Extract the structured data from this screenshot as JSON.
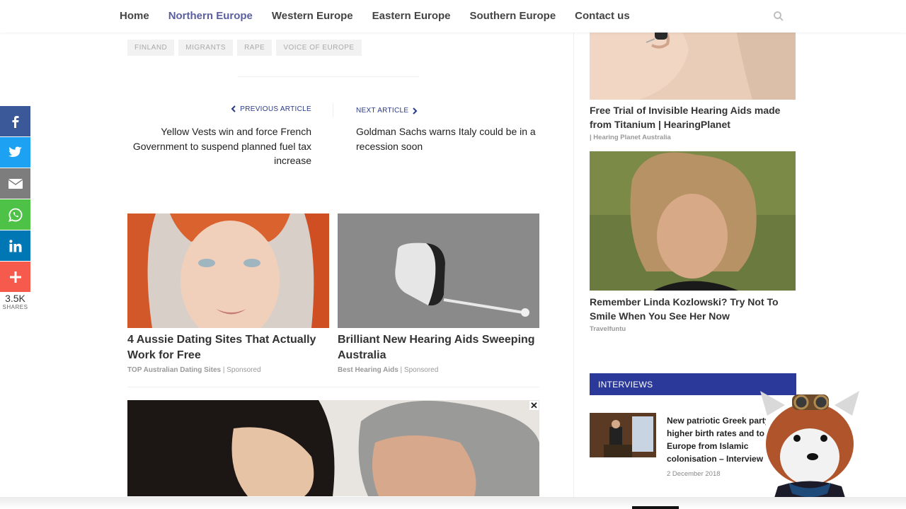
{
  "nav": {
    "items": [
      "Home",
      "Northern Europe",
      "Western Europe",
      "Eastern Europe",
      "Southern Europe",
      "Contact us"
    ],
    "active": "Northern Europe",
    "search_icon": "search-icon"
  },
  "tags": [
    "FINLAND",
    "MIGRANTS",
    "RAPE",
    "VOICE OF EUROPE"
  ],
  "article_nav": {
    "prev_label": "PREVIOUS ARTICLE",
    "prev_title": "Yellow Vests win and force French Government to suspend planned fuel tax increase",
    "next_label": "NEXT ARTICLE",
    "next_title": "Goldman Sachs warns Italy could be in a recession soon"
  },
  "sponsored": [
    {
      "title": "4 Aussie Dating Sites That Actually Work for Free",
      "source": "TOP Australian Dating Sites",
      "tag": "Sponsored"
    },
    {
      "title": "Brilliant New Hearing Aids Sweeping Australia",
      "source": "Best Hearing Aids",
      "tag": "Sponsored"
    }
  ],
  "close_symbol": "✕",
  "sidebar": {
    "ad1": {
      "title": "Free Trial of Invisible Hearing Aids made from Titanium | HearingPlanet",
      "source": "| Hearing Planet Australia"
    },
    "ad2": {
      "title": "Remember Linda Kozlowski? Try Not To Smile When You See Her Now",
      "source": "Travelfuntu"
    },
    "interviews_header": "INTERVIEWS",
    "interview": {
      "title_lines": [
        "New patriotic Greek party",
        "higher birth rates and to",
        "Europe from Islamic",
        "colonisation – Interview"
      ],
      "date": "2 December 2018"
    }
  },
  "share": {
    "buttons": [
      {
        "name": "facebook",
        "color": "#3b5998"
      },
      {
        "name": "twitter",
        "color": "#1da1f2"
      },
      {
        "name": "email",
        "color": "#7d7d7d"
      },
      {
        "name": "whatsapp",
        "color": "#4dc247"
      },
      {
        "name": "linkedin",
        "color": "#0077b5"
      },
      {
        "name": "more",
        "color": "#f65a4d"
      }
    ],
    "count": "3.5K",
    "count_label": "SHARES"
  }
}
